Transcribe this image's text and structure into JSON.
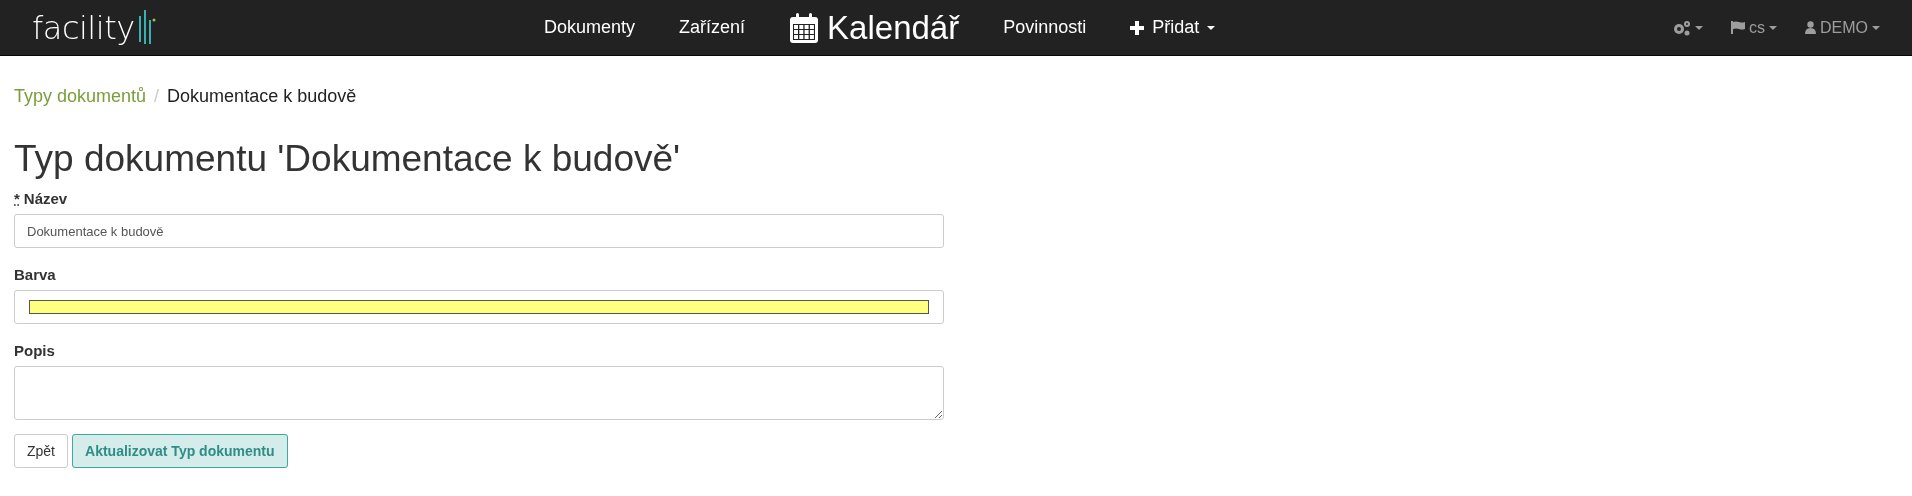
{
  "navbar": {
    "logo": "facility",
    "items": [
      {
        "label": "Dokumenty",
        "kind": "link"
      },
      {
        "label": "Zařízení",
        "kind": "link"
      },
      {
        "label": "Kalendář",
        "kind": "calendar"
      },
      {
        "label": "Povinnosti",
        "kind": "link"
      },
      {
        "label": "Přidat",
        "kind": "add"
      }
    ],
    "right": [
      {
        "kind": "settings"
      },
      {
        "kind": "language",
        "label": "cs"
      },
      {
        "kind": "user",
        "label": "DEMO"
      }
    ]
  },
  "breadcrumb_separator": "/",
  "breadcrumb": [
    {
      "label": "Typy dokumentů",
      "selected": false
    },
    {
      "label": "Dokumentace k budově",
      "selected": true
    }
  ],
  "title": "Typ dokumentu 'Dokumentace k budově'",
  "form": {
    "fields": [
      {
        "kind": "text",
        "label": "Název",
        "required": true,
        "required_mark": "*",
        "value": "Dokumentace k budově"
      },
      {
        "kind": "color",
        "label": "Barva",
        "required": false,
        "color": "#ffff80"
      },
      {
        "kind": "textarea",
        "label": "Popis",
        "required": false
      }
    ]
  },
  "buttons": [
    {
      "label": "Zpět",
      "kind": "default"
    },
    {
      "label": "Aktualizovat Typ dokumentu",
      "kind": "primary"
    }
  ]
}
